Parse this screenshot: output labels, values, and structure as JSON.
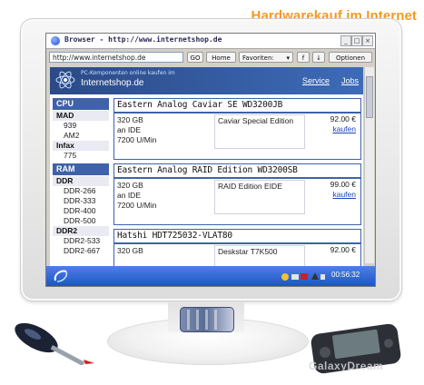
{
  "headline": "Hardwarekauf im Internet",
  "browser": {
    "title": "Browser - http://www.internetshop.de",
    "address": "http://www.internetshop.de",
    "buttons": {
      "go": "GO",
      "home": "Home",
      "favorites": "Favoriten:",
      "favorites_arrow": "▾",
      "f": "f",
      "down": "↓",
      "options": "Optionen"
    },
    "window_buttons": {
      "minimize": "_",
      "maximize": "□",
      "close": "×"
    }
  },
  "site": {
    "tagline": "PC-Komponenten online kaufen im",
    "name": "Internetshop.de",
    "nav": {
      "service": "Service",
      "jobs": "Jobs"
    }
  },
  "sidebar": {
    "cpu": "CPU",
    "mad": "MAD",
    "mad_items": [
      "939",
      "AM2"
    ],
    "infax": "Infax",
    "infax_items": [
      "775"
    ],
    "ram": "RAM",
    "ddr": "DDR",
    "ddr_items": [
      "DDR-266",
      "DDR-333",
      "DDR-400",
      "DDR-500"
    ],
    "ddr2": "DDR2",
    "ddr2_items": [
      "DDR2-533",
      "DDR2-667"
    ]
  },
  "products": [
    {
      "name": "Eastern Analog Caviar SE WD3200JB",
      "capacity": "320 GB",
      "interface": "an IDE",
      "rpm": "7200 U/Min",
      "edition": "Caviar Special Edition",
      "price": "92.00 €",
      "buy": "kaufen"
    },
    {
      "name": "Eastern Analog RAID Edition WD3200SB",
      "capacity": "320 GB",
      "interface": "an IDE",
      "rpm": "7200 U/Min",
      "edition": "RAID Edition EIDE",
      "price": "99.00 €",
      "buy": "kaufen"
    },
    {
      "name": "Hatshi HDT725032-VLAT80",
      "capacity": "320 GB",
      "edition": "Deskstar T7K500",
      "price": "92.00 €"
    }
  ],
  "taskbar": {
    "clock": "00:56:32"
  },
  "watermark": "GalaxyDream",
  "colors": {
    "accent": "#3f62a8",
    "headline": "#f39a1d",
    "taskbar": "#2a62d6",
    "link": "#1f43b8"
  },
  "icons": {
    "browser": "globe-icon",
    "site_logo": "atom-icon",
    "start": "start-swoosh-icon",
    "tray": "tray-icons"
  }
}
